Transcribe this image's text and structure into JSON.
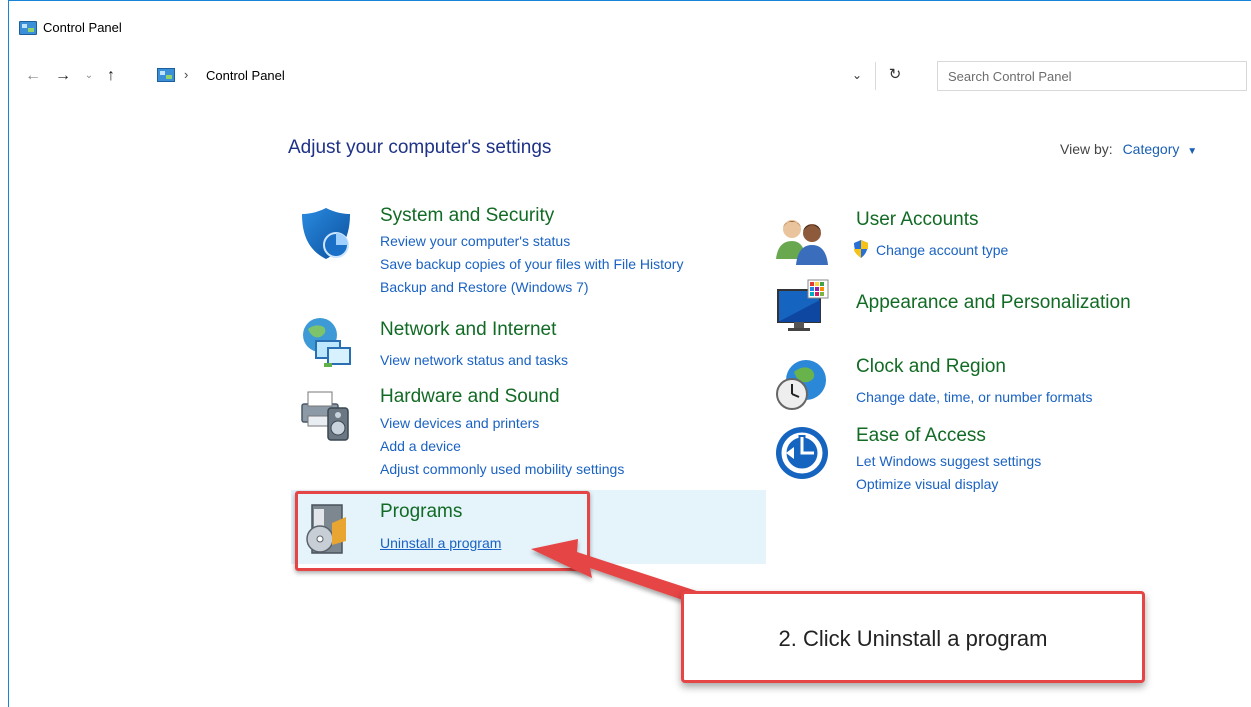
{
  "window": {
    "title": "Control Panel"
  },
  "navigation": {
    "back": "←",
    "forward": "→",
    "recent": "⌄",
    "up": "↑",
    "separator": "›",
    "breadcrumb": "Control Panel",
    "dropdown": "⌄",
    "refresh": "↻"
  },
  "search": {
    "placeholder": "Search Control Panel"
  },
  "main": {
    "heading": "Adjust your computer's settings",
    "view_by_label": "View by:",
    "view_by_value": "Category",
    "view_by_caret": "▼"
  },
  "left_categories": [
    {
      "title": "System and Security",
      "icon": "shield-icon",
      "links": [
        "Review your computer's status",
        "Save backup copies of your files with File History",
        "Backup and Restore (Windows 7)"
      ]
    },
    {
      "title": "Network and Internet",
      "icon": "network-globe-icon",
      "links": [
        "View network status and tasks"
      ]
    },
    {
      "title": "Hardware and Sound",
      "icon": "printer-speaker-icon",
      "links": [
        "View devices and printers",
        "Add a device",
        "Adjust commonly used mobility settings"
      ]
    },
    {
      "title": "Programs",
      "icon": "programs-disc-icon",
      "links": [
        "Uninstall a program"
      ]
    }
  ],
  "right_categories": [
    {
      "title": "User Accounts",
      "icon": "users-icon",
      "links": [
        "Change account type"
      ]
    },
    {
      "title": "Appearance and Personalization",
      "icon": "monitor-palette-icon",
      "links": []
    },
    {
      "title": "Clock and Region",
      "icon": "clock-globe-icon",
      "links": [
        "Change date, time, or number formats"
      ]
    },
    {
      "title": "Ease of Access",
      "icon": "ease-of-access-icon",
      "links": [
        "Let Windows suggest settings",
        "Optimize visual display"
      ]
    }
  ],
  "annotation": {
    "callout_text": "2. Click Uninstall a program",
    "color": "#e64545"
  },
  "colors": {
    "heading": "#1e3287",
    "category_title": "#126b25",
    "link": "#1a62c2",
    "hover": "#e5f3fb"
  }
}
